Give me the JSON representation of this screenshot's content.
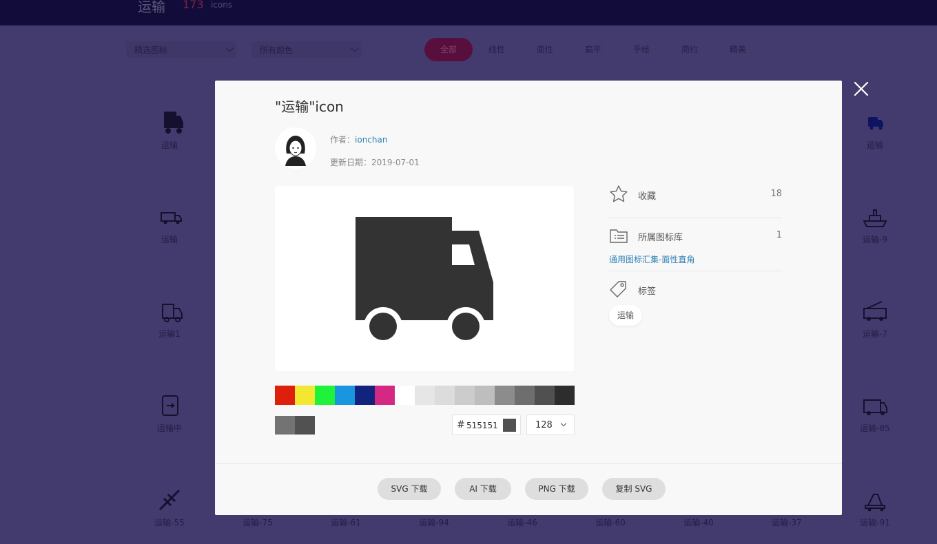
{
  "header": {
    "title": "运输",
    "count": "173",
    "unit": "icons"
  },
  "filters": {
    "featured": "精选图标",
    "colors": "所有颜色"
  },
  "categories": [
    {
      "label": "全部",
      "active": true
    },
    {
      "label": "线性"
    },
    {
      "label": "面性"
    },
    {
      "label": "扁平"
    },
    {
      "label": "手绘"
    },
    {
      "label": "简约"
    },
    {
      "label": "精美"
    }
  ],
  "background_icons": {
    "left_column": [
      {
        "label": "运输",
        "icon": "truck-icon"
      },
      {
        "label": "运输",
        "icon": "delivery-van-icon"
      },
      {
        "label": "运输1",
        "icon": "truck-outline-icon"
      },
      {
        "label": "运输中",
        "icon": "document-transit-icon"
      },
      {
        "label": "运输-55",
        "icon": "plane-icon"
      }
    ],
    "right_column": [
      {
        "label": "运输",
        "icon": "truck-icon"
      },
      {
        "label": "运输-9",
        "icon": "ship-icon"
      },
      {
        "label": "运输-7",
        "icon": "fire-truck-icon"
      },
      {
        "label": "运输-85",
        "icon": "ambulance-icon"
      },
      {
        "label": "运输-91",
        "icon": "crane-truck-icon"
      }
    ],
    "bottom_row": [
      "运输-75",
      "运输-61",
      "运输-94",
      "运输-46",
      "运输-60",
      "运输-40",
      "运输-37"
    ]
  },
  "modal": {
    "title": "\"运输\"icon",
    "author_label": "作者：",
    "author": "ionchan",
    "date_label": "更新日期：",
    "date": "2019-07-01",
    "color_swatches": [
      "#dd1f0b",
      "#f2e831",
      "#1ef23a",
      "#1a96e0",
      "#12237e",
      "#d42882",
      "#ffffff",
      "#e6e6e6",
      "#dcdcdc",
      "#cccccc",
      "#bebebe",
      "#8c8c8c",
      "#6e6e6e",
      "#505050",
      "#2d2d2d"
    ],
    "recent_colors": [
      "#737373",
      "#515151"
    ],
    "hex_symbol": "#",
    "hex_value": "515151",
    "size": "128",
    "favorites": {
      "label": "收藏",
      "count": "18"
    },
    "library": {
      "label": "所属图标库",
      "count": "1",
      "link": "通用图标汇集-面性直角"
    },
    "tags": {
      "label": "标签",
      "items": [
        "运输"
      ]
    },
    "buttons": {
      "svg": "SVG 下载",
      "ai": "AI 下载",
      "png": "PNG 下载",
      "copy": "复制 SVG"
    }
  }
}
